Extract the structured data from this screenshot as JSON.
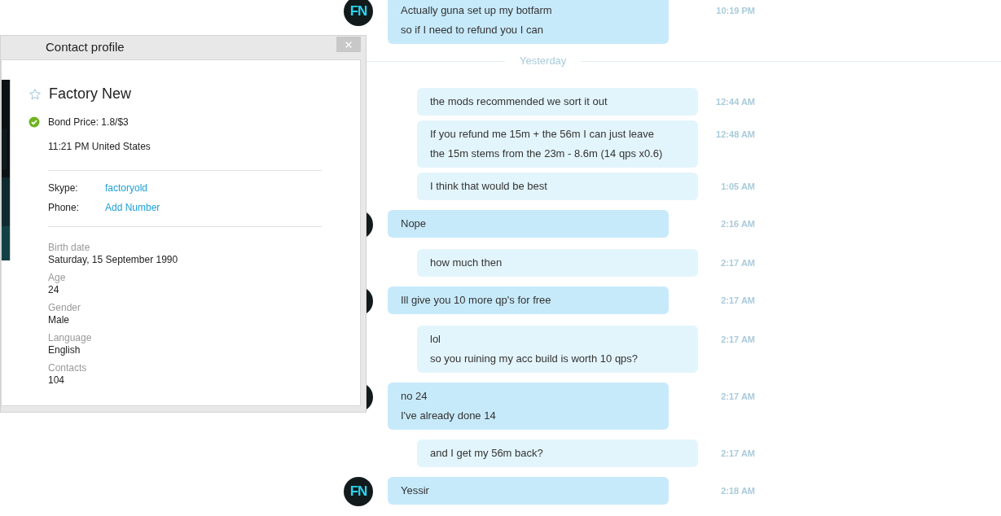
{
  "chat": {
    "items": [
      {
        "kind": "message",
        "outgoing": false,
        "avatar_label": "FN",
        "lines": [
          "Actually guna set up my botfarm",
          "so if I need to refund you I can"
        ],
        "time": "10:19 PM"
      },
      {
        "kind": "date_divider",
        "label": "Yesterday"
      },
      {
        "kind": "message",
        "outgoing": true,
        "lines": [
          "the mods recommended we sort it out"
        ],
        "time": "12:44 AM"
      },
      {
        "kind": "message",
        "outgoing": true,
        "lines": [
          "If you refund me 15m + the 56m I can just leave",
          "the 15m stems from the 23m - 8.6m (14 qps x0.6)"
        ],
        "time": "12:48 AM"
      },
      {
        "kind": "message",
        "outgoing": true,
        "lines": [
          "I think that would be best"
        ],
        "time": "1:05 AM"
      },
      {
        "kind": "message",
        "outgoing": false,
        "lines": [
          "Nope"
        ],
        "time": "2:16 AM"
      },
      {
        "kind": "message",
        "outgoing": true,
        "lines": [
          "how much then"
        ],
        "time": "2:17 AM"
      },
      {
        "kind": "message",
        "outgoing": false,
        "lines": [
          "Ill give you 10 more qp's for free"
        ],
        "time": "2:17 AM"
      },
      {
        "kind": "message",
        "outgoing": true,
        "lines": [
          "lol",
          "so you ruining my acc build is worth 10 qps?"
        ],
        "time": "2:17 AM"
      },
      {
        "kind": "message",
        "outgoing": false,
        "lines": [
          "no 24",
          "I've already done 14"
        ],
        "time": "2:17 AM"
      },
      {
        "kind": "message",
        "outgoing": true,
        "lines": [
          "and I get my 56m back?"
        ],
        "time": "2:17 AM"
      },
      {
        "kind": "message",
        "outgoing": false,
        "avatar_label": "FN",
        "lines": [
          "Yessir"
        ],
        "time": "2:18 AM"
      }
    ]
  },
  "profile_dialog": {
    "title": "Contact profile",
    "name": "Factory New",
    "favorite": false,
    "online": true,
    "mood": "Bond Price: 1.8/$3",
    "local_time": "11:21 PM United States",
    "contacts": [
      {
        "label": "Skype:",
        "value": "factoryold"
      },
      {
        "label": "Phone:",
        "value": "Add Number"
      }
    ],
    "details": [
      {
        "label": "Birth date",
        "value": "Saturday, 15 September 1990"
      },
      {
        "label": "Age",
        "value": "24"
      },
      {
        "label": "Gender",
        "value": "Male"
      },
      {
        "label": "Language",
        "value": "English"
      },
      {
        "label": "Contacts",
        "value": "104"
      }
    ]
  }
}
